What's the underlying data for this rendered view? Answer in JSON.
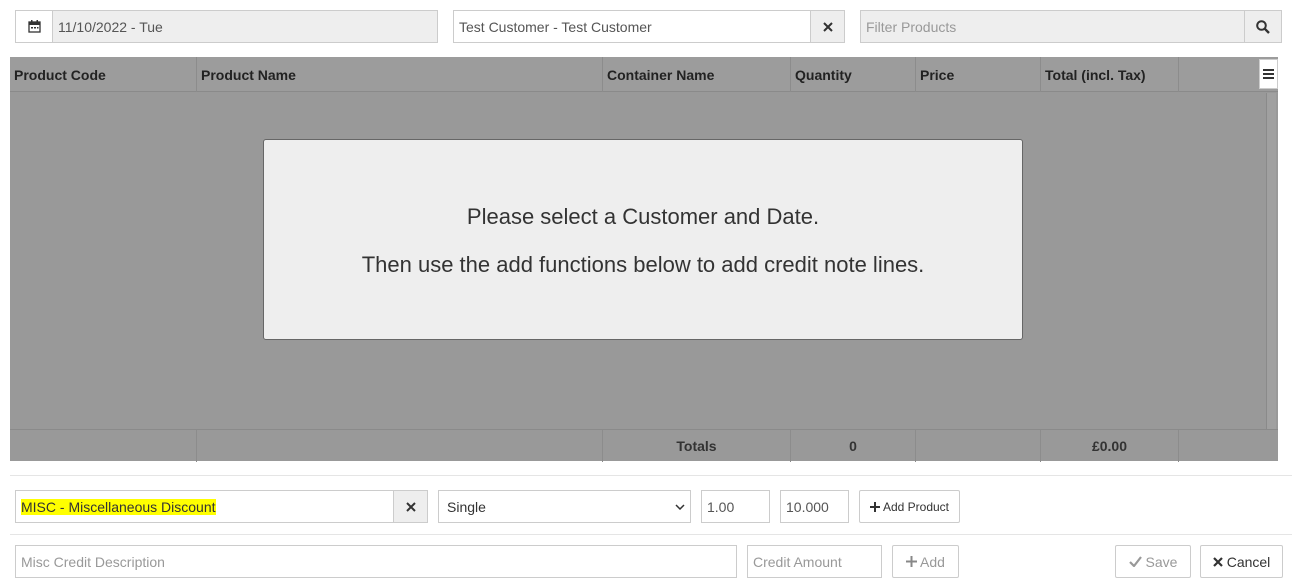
{
  "toolbar": {
    "date_value": "11/10/2022 - Tue",
    "customer_value": "Test Customer - Test Customer",
    "filter_placeholder": "Filter Products"
  },
  "grid": {
    "columns": [
      "Product Code",
      "Product Name",
      "Container Name",
      "Quantity",
      "Price",
      "Total (incl. Tax)"
    ],
    "overlay_line1": "Please select a Customer and Date.",
    "overlay_line2": "Then use the add functions below to add credit note lines.",
    "footer": {
      "totals_label": "Totals",
      "quantity_total": "0",
      "amount_total": "£0.00"
    }
  },
  "add_product": {
    "product_value": "MISC - Miscellaneous Discount",
    "unit_selected": "Single",
    "quantity_value": "1.00",
    "price_value": "10.000",
    "add_label": "Add Product"
  },
  "misc_credit": {
    "description_placeholder": "Misc Credit Description",
    "amount_placeholder": "Credit Amount",
    "add_label": "Add"
  },
  "actions": {
    "save_label": "Save",
    "cancel_label": "Cancel"
  },
  "colors": {
    "highlight": "#ffff00",
    "grid_background": "#999999",
    "overlay_background": "#eeeeee"
  }
}
